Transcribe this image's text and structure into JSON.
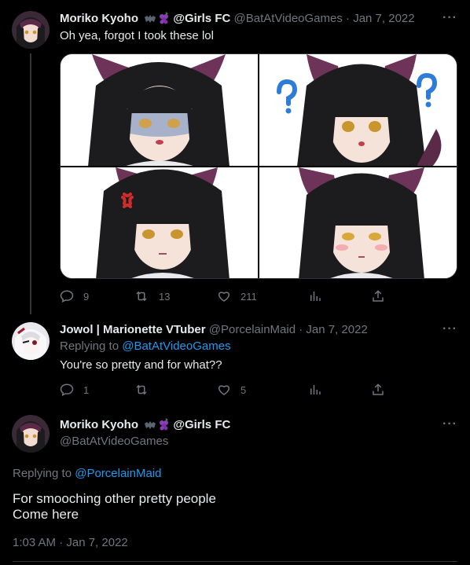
{
  "tweet1": {
    "display_name": "Moriko Kyoho",
    "name_suffix": "@Girls FC",
    "handle": "@BatAtVideoGames",
    "separator": "·",
    "date": "Jan 7, 2022",
    "text": "Oh yea, forgot I took these lol",
    "more_glyph": "···",
    "replies": "9",
    "retweets": "13",
    "likes": "211"
  },
  "tweet2": {
    "display_name": "Jowol | Marionette VTuber",
    "handle": "@PorcelainMaid",
    "separator": "·",
    "date": "Jan 7, 2022",
    "replying_prefix": "Replying to",
    "replying_to": "@BatAtVideoGames",
    "text": "You're so pretty and for what??",
    "more_glyph": "···",
    "replies": "1",
    "retweets": "",
    "likes": "5"
  },
  "tweet3": {
    "display_name": "Moriko Kyoho",
    "name_suffix": "@Girls FC",
    "handle": "@BatAtVideoGames",
    "more_glyph": "···",
    "replying_prefix": "Replying to",
    "replying_to": "@PorcelainMaid",
    "text_line1": "For smooching other pretty people",
    "text_line2": "Come here",
    "timestamp": "1:03 AM · Jan 7, 2022"
  },
  "icons": [
    "reply-icon",
    "retweet-icon",
    "like-icon",
    "analytics-icon",
    "share-icon",
    "bat-emoji-icon",
    "grapes-emoji-icon",
    "question-mark-icon",
    "anger-mark-icon"
  ],
  "colors": {
    "background": "#000000",
    "text": "#e7e9ea",
    "muted": "#71767b",
    "link": "#1d9bf0",
    "thread_line": "#333639",
    "hair": "#1c1c1e",
    "ear": "#6e3358",
    "eye": "#c8952e"
  }
}
